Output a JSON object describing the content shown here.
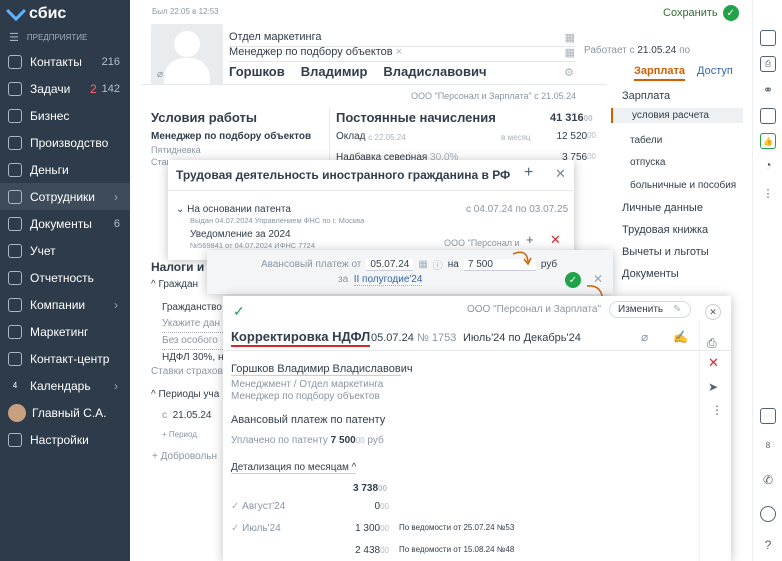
{
  "sidebar": {
    "logo": "сбис",
    "enterprise": "ПРЕДПРИЯТИЕ",
    "items": [
      {
        "label": "Контакты",
        "count": "216"
      },
      {
        "label": "Задачи",
        "red": "2",
        "count": "142"
      },
      {
        "label": "Бизнес"
      },
      {
        "label": "Производство"
      },
      {
        "label": "Деньги"
      },
      {
        "label": "Сотрудники",
        "chev": "›"
      },
      {
        "label": "Документы",
        "count": "6"
      },
      {
        "label": "Учет"
      },
      {
        "label": "Отчетность"
      },
      {
        "label": "Компании",
        "chev": "›"
      },
      {
        "label": "Маркетинг"
      },
      {
        "label": "Контакт-центр"
      },
      {
        "label": "Календарь",
        "chev": "›",
        "badge": "4"
      },
      {
        "label": "Главный С.А."
      },
      {
        "label": "Настройки"
      }
    ]
  },
  "header": {
    "last_seen": "Был 22.05 в 12:53",
    "save": "Сохранить",
    "department": "Отдел маркетинга",
    "position": "Менеджер по подбору объектов",
    "last_name": "Горшков",
    "first_name": "Владимир",
    "patronymic": "Владиславович",
    "works_since_label": "Работает с",
    "works_since": "21.05.24",
    "works_since_suffix": "по",
    "tabs": [
      "Зарплата",
      "Доступ"
    ]
  },
  "right_nav": [
    "Зарплата",
    "условия расчета",
    "табели",
    "отпуска",
    "больничные и пособия",
    "Личные данные",
    "Трудовая книжка",
    "Вычеты и льготы",
    "Документы"
  ],
  "company_line": "ООО \"Персонал и Зарплата\"  с 21.05.24",
  "conditions": {
    "title": "Условия работы",
    "position": "Менеджер по подбору объектов",
    "week": "Пятидневка",
    "stag": "Стаг"
  },
  "accruals": {
    "title": "Постоянные начисления",
    "total": "41 316",
    "total_dec": "00",
    "rows": [
      {
        "name": "Оклад",
        "date": "с 22.05.24",
        "per": "в месяц",
        "value": "12 520",
        "dec": "00"
      },
      {
        "name": "Надбавка северная",
        "pct": "30.0%",
        "value": "3 756",
        "dec": "00"
      }
    ]
  },
  "taxes": {
    "title": "Налоги и",
    "grazhd": "Граждан",
    "lines": [
      "Гражданство",
      "Укажите дан",
      "Без особого"
    ],
    "ndfl": "НДФЛ 30%, н",
    "insur": "Ставки страхов",
    "periods": "Периоды уча",
    "from": "с",
    "from_date": "21.05.24",
    "add_period": "+ Период",
    "add_vol": "+ Добровольн"
  },
  "foreign": {
    "title": "Трудовая деятельность иностранного гражданина в РФ",
    "basis": "На основании патента",
    "basis_dates": "с 04.07.24 по 03.07.25",
    "issued": "Выдан 04.07.2024 Управлением ФНС по г. Москва",
    "notice": "Уведомление за 2024",
    "notice_sub": "№569841 от 04.07.2024 ИФНС 7724",
    "notice_org": "ООО \"Персонал и"
  },
  "advance": {
    "label": "Авансовый платеж от",
    "date": "05.07.24",
    "on": "на",
    "amount": "7 500",
    "currency": "руб",
    "period_pre": "за",
    "period": "II полугодие'24"
  },
  "doc": {
    "org": "ООО \"Персонал и Зарплата\"",
    "edit": "Изменить",
    "title": "Корректировка НДФЛ",
    "date": "05.07.24",
    "num_prefix": "№",
    "num": "1753",
    "period": "Июль'24 по Декабрь'24",
    "employee": "Горшков Владимир Владиславович",
    "dept": "Менеджмент / Отдел маркетинга",
    "pos": "Менеджер по подбору объектов",
    "desc": "Авансовый платеж по патенту",
    "paid_label": "Уплачено по патенту",
    "paid": "7 500",
    "paid_dec": "00",
    "paid_cur": "руб",
    "detail": "Детализация по месяцам",
    "total": "3 738",
    "total_dec": "00",
    "rows": [
      {
        "month": "Август'24",
        "value": "0",
        "dec": "00",
        "note": ""
      },
      {
        "month": "Июль'24",
        "value": "1 300",
        "dec": "00",
        "note": "По ведомости от 25.07.24 №53"
      },
      {
        "month": "",
        "value": "2 438",
        "dec": "00",
        "note": "По ведомости от 15.08.24 №48"
      }
    ]
  },
  "colors": {
    "sidebar": "#2e3b4a",
    "accent": "#d35f00",
    "green": "#21a34a",
    "red": "#d12a2a"
  }
}
